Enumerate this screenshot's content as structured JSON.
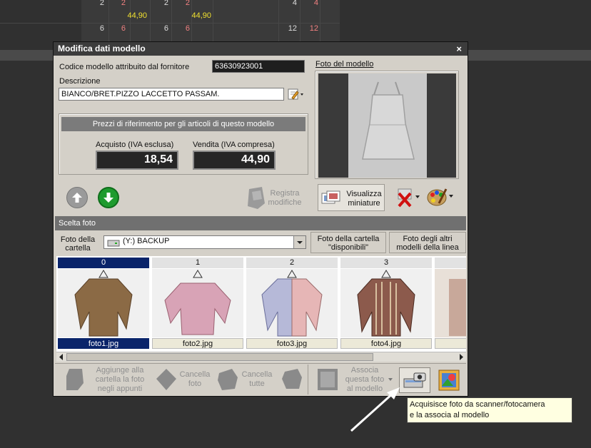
{
  "background_sheet": {
    "row1": [
      "2",
      "2",
      "2",
      "2",
      "4",
      "4"
    ],
    "row2": [
      "44,90",
      "44,90"
    ],
    "row3": [
      "6",
      "6",
      "6",
      "6",
      "12",
      "12"
    ]
  },
  "dialog": {
    "title": "Modifica dati modello",
    "close_label": "×",
    "supplier_code_label": "Codice modello attribuito dal fornitore",
    "supplier_code_value": "63630923001",
    "description_label": "Descrizione",
    "description_value": "BIANCO/BRET.PIZZO LACCETTO PASSAM.",
    "photo_link": "Foto del modello",
    "prices": {
      "header": "Prezzi di riferimento per gli articoli di questo modello",
      "purchase_label": "Acquisto (IVA esclusa)",
      "purchase_value": "18,54",
      "sale_label": "Vendita (IVA compresa)",
      "sale_value": "44,90"
    },
    "save_label_1": "Registra",
    "save_label_2": "modifiche",
    "view_thumbs_1": "Visualizza",
    "view_thumbs_2": "miniature",
    "scelta_foto": "Scelta foto",
    "folder_photos_1": "Foto della",
    "folder_photos_2": "cartella",
    "drive_value": "(Y:)  BACKUP",
    "available_1": "Foto della cartella",
    "available_2": "\"disponibili\"",
    "others_1": "Foto degli altri",
    "others_2": "modelli della linea",
    "thumbnails": [
      {
        "index": "0",
        "file": "foto1.jpg",
        "color": "#8b6a45"
      },
      {
        "index": "1",
        "file": "foto2.jpg",
        "color": "#d8a3b6"
      },
      {
        "index": "2",
        "file": "foto3.jpg",
        "color": "#b6b9d8"
      },
      {
        "index": "3",
        "file": "foto4.jpg",
        "color": "#8c5a4c"
      }
    ],
    "toolbar": {
      "add_1": "Aggiunge alla",
      "add_2": "cartella la foto",
      "add_3": "negli appunti",
      "delete_1": "Cancella",
      "delete_2": "foto",
      "delete_all_1": "Cancella",
      "delete_all_2": "tutte",
      "assoc_1": "Associa",
      "assoc_2": "questa foto",
      "assoc_3": "al modello"
    }
  },
  "tooltip": {
    "line1": "Acquisisce foto da scanner/fotocamera",
    "line2": "e la associa al modello"
  },
  "colors": {
    "accent_green": "#1e9b2e",
    "selection_blue": "#0a246a",
    "price_bg": "#262626"
  }
}
